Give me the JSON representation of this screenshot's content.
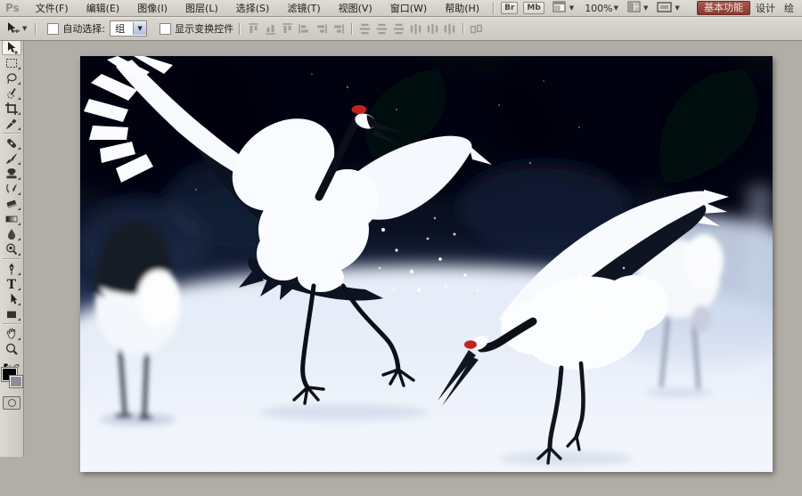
{
  "app": {
    "logo": "Ps"
  },
  "menu_bar": {
    "items": [
      "文件(F)",
      "编辑(E)",
      "图像(I)",
      "图层(L)",
      "选择(S)",
      "滤镜(T)",
      "视图(V)",
      "窗口(W)",
      "帮助(H)"
    ],
    "bridge_button": "Br",
    "mini_bridge_button": "Mb",
    "zoom_level": "100%",
    "workspaces": {
      "active": "基本功能",
      "second": "设计",
      "third": "绘"
    }
  },
  "options_bar": {
    "auto_select": {
      "label": "自动选择:",
      "checked": false,
      "value": "组"
    },
    "show_transform": {
      "label": "显示变换控件",
      "checked": false
    },
    "align_icons": [
      "align-top-edges",
      "align-vertical-centers",
      "align-bottom-edges",
      "align-left-edges",
      "align-horizontal-centers",
      "align-right-edges",
      "distribute-top-edges",
      "distribute-vertical-centers",
      "distribute-bottom-edges",
      "distribute-left-edges",
      "distribute-horizontal-centers",
      "distribute-right-edges",
      "auto-align-layers"
    ]
  },
  "tools_panel": {
    "selected_tool": "move",
    "tools": [
      "move",
      "rectangular-marquee",
      "lasso",
      "quick-selection",
      "crop",
      "eyedropper",
      "spot-healing-brush",
      "brush",
      "clone-stamp",
      "history-brush",
      "eraser",
      "gradient",
      "blur",
      "dodge",
      "pen",
      "type",
      "path-selection",
      "rectangle-shape",
      "hand",
      "zoom"
    ],
    "foreground_color": "#000000",
    "background_color": "#8a8f96"
  },
  "canvas": {
    "zoom_level": "100%",
    "photo_colors": {
      "sky_dark": "#05080f",
      "sky_navy": "#141f38",
      "snow": "#f2f5fc",
      "crane_white": "#fafcff",
      "crane_black": "#0c1220",
      "crown_red": "#c12220",
      "surround_gray": "#b1aea7"
    }
  }
}
